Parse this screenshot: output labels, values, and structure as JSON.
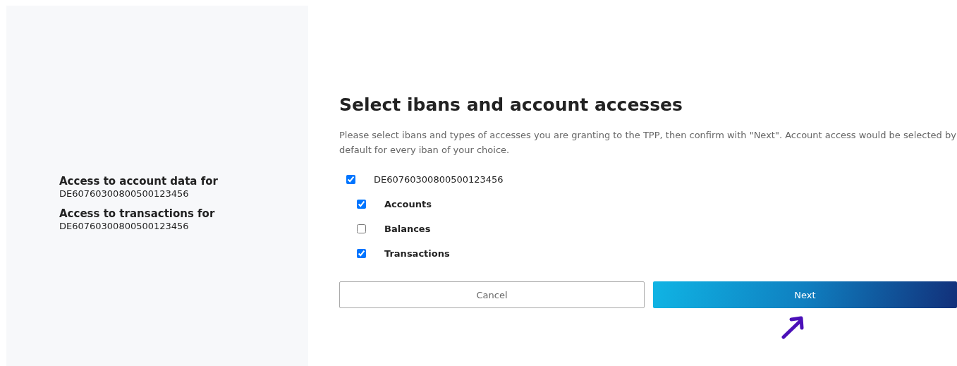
{
  "summary": [
    {
      "label": "Access to account data for",
      "iban": "DE60760300800500123456"
    },
    {
      "label": "Access to transactions for",
      "iban": "DE60760300800500123456"
    }
  ],
  "title": "Select ibans and account accesses",
  "description": "Please select ibans and types of accesses you are granting to the TPP, then confirm with \"Next\". Account access would be selected by default for every iban of your choice.",
  "ibans": [
    {
      "label": "DE60760300800500123456",
      "checked": true,
      "children": [
        {
          "label": "Accounts",
          "checked": true
        },
        {
          "label": "Balances",
          "checked": false
        },
        {
          "label": "Transactions",
          "checked": true
        }
      ]
    }
  ],
  "buttons": [
    {
      "label": "Cancel",
      "kind": "secondary"
    },
    {
      "label": "Next",
      "kind": "primary"
    }
  ]
}
